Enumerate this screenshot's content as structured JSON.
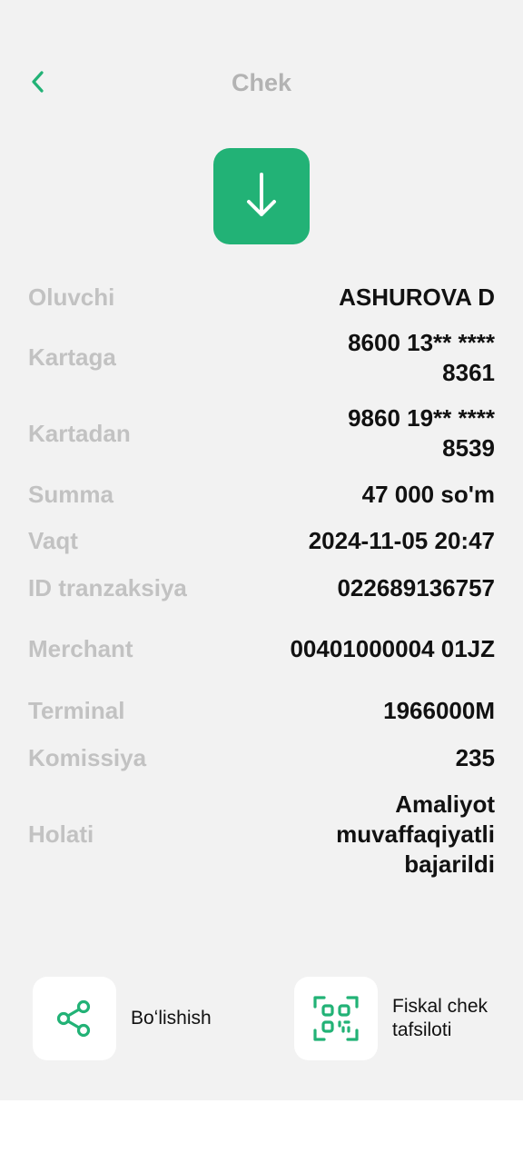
{
  "header": {
    "title": "Chek"
  },
  "details": [
    {
      "label": "Oluvchi",
      "value": "ASHUROVA D"
    },
    {
      "label": "Kartaga",
      "value": "8600 13** **** 8361"
    },
    {
      "label": "Kartadan",
      "value": "9860 19** **** 8539"
    },
    {
      "label": "Summa",
      "value": "47 000 so'm"
    },
    {
      "label": "Vaqt",
      "value": "2024-11-05 20:47"
    },
    {
      "label": "ID tranzaksiya",
      "value": "022689136757"
    },
    {
      "label": "Merchant",
      "value": "00401000004 01JZ"
    },
    {
      "label": "Terminal",
      "value": "1966000M"
    },
    {
      "label": "Komissiya",
      "value": "235"
    },
    {
      "label": "Holati",
      "value": "Amaliyot muvaffaqiyatli bajarildi"
    }
  ],
  "actions": {
    "share_label": "Boʻlishish",
    "fiscal_label": "Fiskal chek tafsiloti"
  },
  "colors": {
    "accent": "#22b276",
    "label": "#c2c2c2",
    "value": "#111111",
    "background": "#f2f2f2"
  },
  "icons": {
    "back": "chevron-left-icon",
    "download": "arrow-down-icon",
    "share": "share-icon",
    "fiscal": "qr-scan-icon"
  }
}
